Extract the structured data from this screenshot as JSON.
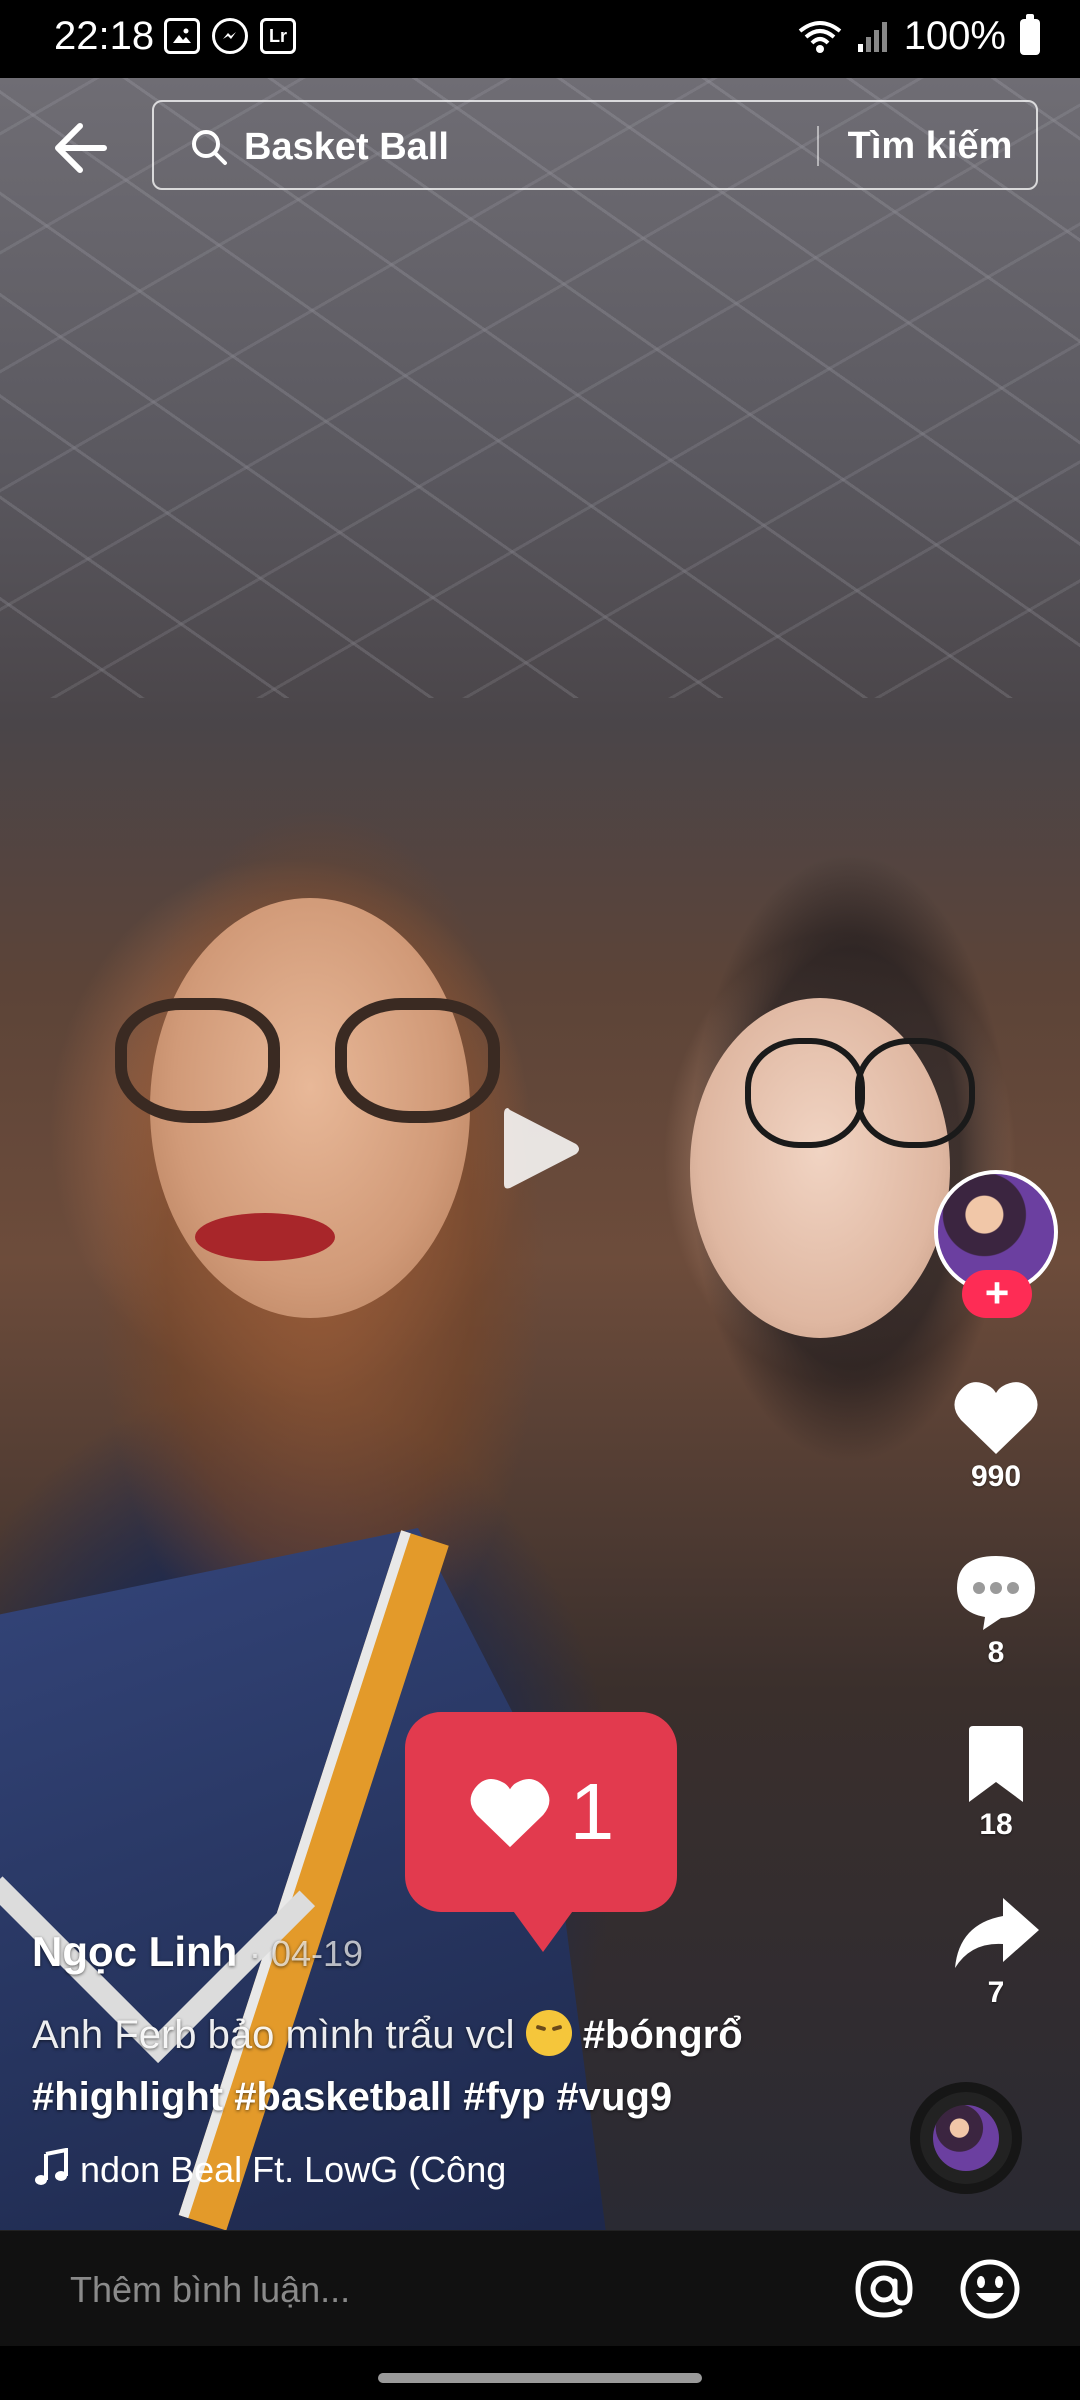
{
  "status_bar": {
    "time": "22:18",
    "battery": "100%",
    "notification_icons": [
      "gallery-icon",
      "messenger-icon",
      "lightroom-icon"
    ],
    "lr_label": "Lr"
  },
  "search": {
    "query": "Basket Ball",
    "button_label": "Tìm kiếm"
  },
  "video": {
    "author": "Ngọc Linh",
    "date": "· 04-19",
    "caption_text": "Anh Ferb bảo mình trẩu vcl",
    "hashtags_line1": "#bóngrổ",
    "hashtags_line2": "#highlight #basketball #fyp #vug9",
    "music": "ndon Beal Ft. LowG (Công",
    "like_popup_count": "1"
  },
  "actions": {
    "likes": "990",
    "comments": "8",
    "saves": "18",
    "shares": "7",
    "follow_symbol": "+"
  },
  "comment_bar": {
    "placeholder": "Thêm bình luận..."
  },
  "colors": {
    "accent": "#fe2c55",
    "like_popup": "#e23a4e"
  }
}
